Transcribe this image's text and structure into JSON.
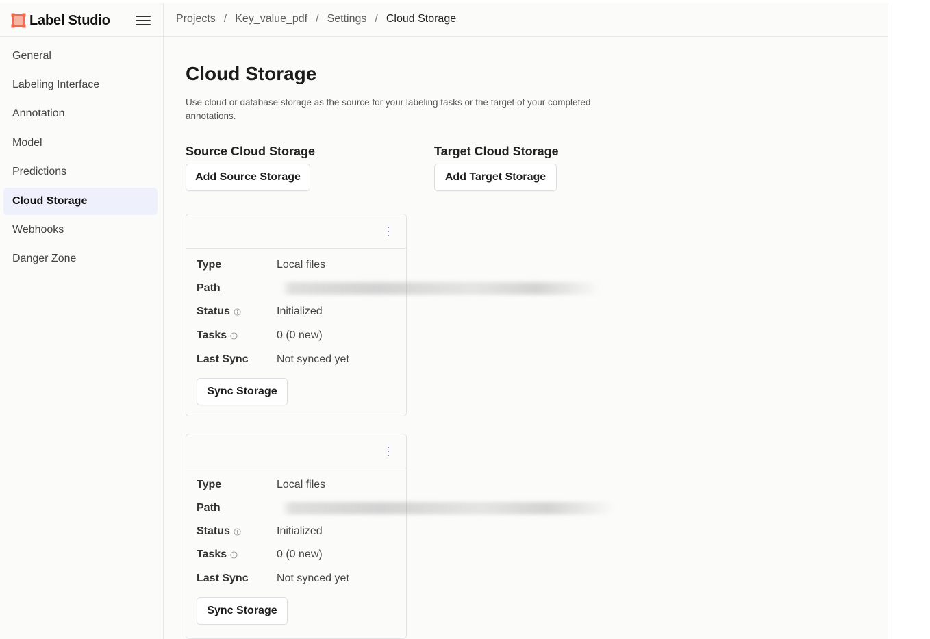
{
  "app": {
    "brand": "Label Studio"
  },
  "breadcrumb": [
    {
      "label": "Projects"
    },
    {
      "label": "Key_value_pdf"
    },
    {
      "label": "Settings"
    },
    {
      "label": "Cloud Storage"
    }
  ],
  "breadcrumb_separator": "/",
  "sidebar": {
    "items": [
      {
        "label": "General",
        "active": false
      },
      {
        "label": "Labeling Interface",
        "active": false
      },
      {
        "label": "Annotation",
        "active": false
      },
      {
        "label": "Model",
        "active": false
      },
      {
        "label": "Predictions",
        "active": false
      },
      {
        "label": "Cloud Storage",
        "active": true
      },
      {
        "label": "Webhooks",
        "active": false
      },
      {
        "label": "Danger Zone",
        "active": false
      }
    ]
  },
  "main": {
    "title": "Cloud Storage",
    "description": "Use cloud or database storage as the source for your labeling tasks or the target of your completed annotations.",
    "source": {
      "title": "Source Cloud Storage",
      "button": "Add Source Storage"
    },
    "target": {
      "title": "Target Cloud Storage",
      "button": "Add Target Storage"
    },
    "cards": [
      {
        "labels": {
          "type": "Type",
          "path": "Path",
          "status": "Status",
          "tasks": "Tasks",
          "last_sync": "Last Sync"
        },
        "type": "Local files",
        "path": "",
        "status": "Initialized",
        "tasks": "0 (0 new)",
        "last_sync": "Not synced yet",
        "sync_button": "Sync Storage"
      },
      {
        "labels": {
          "type": "Type",
          "path": "Path",
          "status": "Status",
          "tasks": "Tasks",
          "last_sync": "Last Sync"
        },
        "type": "Local files",
        "path": "",
        "status": "Initialized",
        "tasks": "0 (0 new)",
        "last_sync": "Not synced yet",
        "sync_button": "Sync Storage"
      }
    ]
  },
  "colors": {
    "accent": "#5a63c9",
    "active_nav_bg": "#eef0fb",
    "logo": "#f26a4b"
  }
}
